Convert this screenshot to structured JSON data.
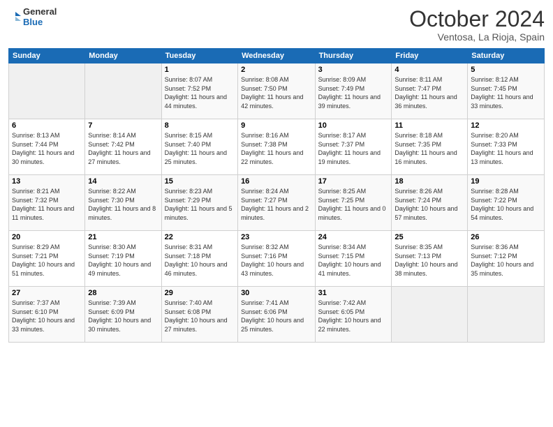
{
  "logo": {
    "line1": "General",
    "line2": "Blue"
  },
  "title": "October 2024",
  "location": "Ventosa, La Rioja, Spain",
  "days_of_week": [
    "Sunday",
    "Monday",
    "Tuesday",
    "Wednesday",
    "Thursday",
    "Friday",
    "Saturday"
  ],
  "weeks": [
    [
      {
        "day": "",
        "info": ""
      },
      {
        "day": "",
        "info": ""
      },
      {
        "day": "1",
        "info": "Sunrise: 8:07 AM\nSunset: 7:52 PM\nDaylight: 11 hours and 44 minutes."
      },
      {
        "day": "2",
        "info": "Sunrise: 8:08 AM\nSunset: 7:50 PM\nDaylight: 11 hours and 42 minutes."
      },
      {
        "day": "3",
        "info": "Sunrise: 8:09 AM\nSunset: 7:49 PM\nDaylight: 11 hours and 39 minutes."
      },
      {
        "day": "4",
        "info": "Sunrise: 8:11 AM\nSunset: 7:47 PM\nDaylight: 11 hours and 36 minutes."
      },
      {
        "day": "5",
        "info": "Sunrise: 8:12 AM\nSunset: 7:45 PM\nDaylight: 11 hours and 33 minutes."
      }
    ],
    [
      {
        "day": "6",
        "info": "Sunrise: 8:13 AM\nSunset: 7:44 PM\nDaylight: 11 hours and 30 minutes."
      },
      {
        "day": "7",
        "info": "Sunrise: 8:14 AM\nSunset: 7:42 PM\nDaylight: 11 hours and 27 minutes."
      },
      {
        "day": "8",
        "info": "Sunrise: 8:15 AM\nSunset: 7:40 PM\nDaylight: 11 hours and 25 minutes."
      },
      {
        "day": "9",
        "info": "Sunrise: 8:16 AM\nSunset: 7:38 PM\nDaylight: 11 hours and 22 minutes."
      },
      {
        "day": "10",
        "info": "Sunrise: 8:17 AM\nSunset: 7:37 PM\nDaylight: 11 hours and 19 minutes."
      },
      {
        "day": "11",
        "info": "Sunrise: 8:18 AM\nSunset: 7:35 PM\nDaylight: 11 hours and 16 minutes."
      },
      {
        "day": "12",
        "info": "Sunrise: 8:20 AM\nSunset: 7:33 PM\nDaylight: 11 hours and 13 minutes."
      }
    ],
    [
      {
        "day": "13",
        "info": "Sunrise: 8:21 AM\nSunset: 7:32 PM\nDaylight: 11 hours and 11 minutes."
      },
      {
        "day": "14",
        "info": "Sunrise: 8:22 AM\nSunset: 7:30 PM\nDaylight: 11 hours and 8 minutes."
      },
      {
        "day": "15",
        "info": "Sunrise: 8:23 AM\nSunset: 7:29 PM\nDaylight: 11 hours and 5 minutes."
      },
      {
        "day": "16",
        "info": "Sunrise: 8:24 AM\nSunset: 7:27 PM\nDaylight: 11 hours and 2 minutes."
      },
      {
        "day": "17",
        "info": "Sunrise: 8:25 AM\nSunset: 7:25 PM\nDaylight: 11 hours and 0 minutes."
      },
      {
        "day": "18",
        "info": "Sunrise: 8:26 AM\nSunset: 7:24 PM\nDaylight: 10 hours and 57 minutes."
      },
      {
        "day": "19",
        "info": "Sunrise: 8:28 AM\nSunset: 7:22 PM\nDaylight: 10 hours and 54 minutes."
      }
    ],
    [
      {
        "day": "20",
        "info": "Sunrise: 8:29 AM\nSunset: 7:21 PM\nDaylight: 10 hours and 51 minutes."
      },
      {
        "day": "21",
        "info": "Sunrise: 8:30 AM\nSunset: 7:19 PM\nDaylight: 10 hours and 49 minutes."
      },
      {
        "day": "22",
        "info": "Sunrise: 8:31 AM\nSunset: 7:18 PM\nDaylight: 10 hours and 46 minutes."
      },
      {
        "day": "23",
        "info": "Sunrise: 8:32 AM\nSunset: 7:16 PM\nDaylight: 10 hours and 43 minutes."
      },
      {
        "day": "24",
        "info": "Sunrise: 8:34 AM\nSunset: 7:15 PM\nDaylight: 10 hours and 41 minutes."
      },
      {
        "day": "25",
        "info": "Sunrise: 8:35 AM\nSunset: 7:13 PM\nDaylight: 10 hours and 38 minutes."
      },
      {
        "day": "26",
        "info": "Sunrise: 8:36 AM\nSunset: 7:12 PM\nDaylight: 10 hours and 35 minutes."
      }
    ],
    [
      {
        "day": "27",
        "info": "Sunrise: 7:37 AM\nSunset: 6:10 PM\nDaylight: 10 hours and 33 minutes."
      },
      {
        "day": "28",
        "info": "Sunrise: 7:39 AM\nSunset: 6:09 PM\nDaylight: 10 hours and 30 minutes."
      },
      {
        "day": "29",
        "info": "Sunrise: 7:40 AM\nSunset: 6:08 PM\nDaylight: 10 hours and 27 minutes."
      },
      {
        "day": "30",
        "info": "Sunrise: 7:41 AM\nSunset: 6:06 PM\nDaylight: 10 hours and 25 minutes."
      },
      {
        "day": "31",
        "info": "Sunrise: 7:42 AM\nSunset: 6:05 PM\nDaylight: 10 hours and 22 minutes."
      },
      {
        "day": "",
        "info": ""
      },
      {
        "day": "",
        "info": ""
      }
    ]
  ]
}
